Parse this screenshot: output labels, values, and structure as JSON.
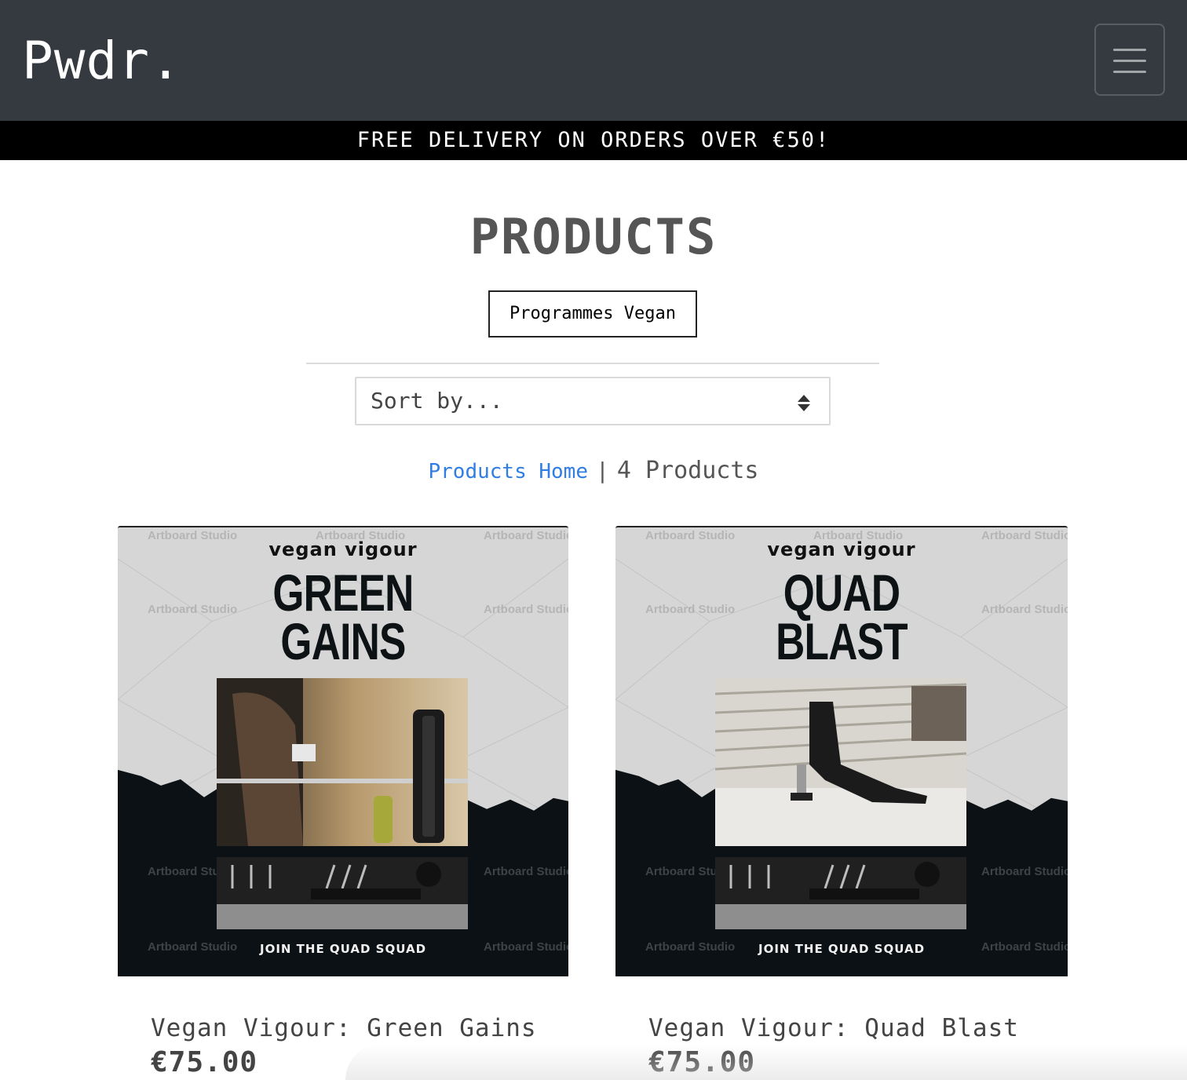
{
  "navbar": {
    "brand": "Pwdr.",
    "toggler_icon": "hamburger-menu-icon"
  },
  "banner": {
    "text": "FREE DELIVERY ON ORDERS OVER €50!"
  },
  "products_page": {
    "title": "PRODUCTS",
    "tag_filter": "Programmes Vegan",
    "sort": {
      "selected": "Sort by..."
    },
    "breadcrumb": {
      "home_link": "Products Home",
      "separator": "|",
      "count_text": "4 Products"
    }
  },
  "products": [
    {
      "name": "Vegan Vigour: Green Gains",
      "price": "€75.00",
      "image": {
        "kicker": "vegan vigour",
        "headline_line1": "GREEN",
        "headline_line2": "GAINS",
        "tagline": "JOIN THE QUAD SQUAD",
        "watermark": "Artboard Studio"
      }
    },
    {
      "name": "Vegan Vigour: Quad Blast",
      "price": "€75.00",
      "image": {
        "kicker": "vegan vigour",
        "headline_line1": "QUAD",
        "headline_line2": "BLAST",
        "tagline": "JOIN THE QUAD SQUAD",
        "watermark": "Artboard Studio"
      }
    }
  ],
  "colors": {
    "navbar_bg": "#343a40",
    "banner_bg": "#000000",
    "link": "#2f7ee3",
    "poster_dark": "#0b1114"
  }
}
